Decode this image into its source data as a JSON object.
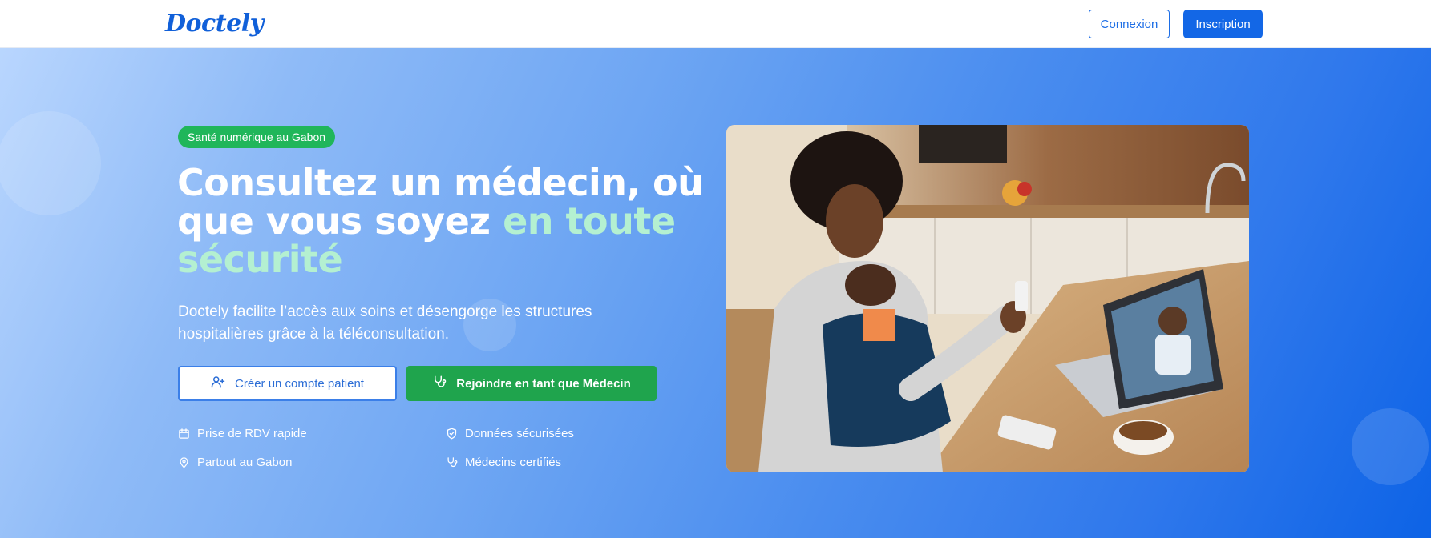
{
  "header": {
    "logo_text": "Doctely",
    "login_label": "Connexion",
    "signup_label": "Inscription"
  },
  "hero": {
    "badge": "Santé numérique au Gabon",
    "title_part1": "Consultez un médecin, où que vous soyez ",
    "title_highlight": "en toute sécurité",
    "description": "Doctely facilite l’accès aux soins et désengorge les structures hospitalières grâce à la téléconsultation.",
    "cta_patient": "Créer un compte patient",
    "cta_doctor": "Rejoindre en tant que Médecin",
    "features": [
      {
        "label": "Prise de RDV rapide",
        "icon": "calendar-icon"
      },
      {
        "label": "Données sécurisées",
        "icon": "shield-check-icon"
      },
      {
        "label": "Partout au Gabon",
        "icon": "map-pin-icon"
      },
      {
        "label": "Médecins certifiés",
        "icon": "stethoscope-icon"
      }
    ]
  },
  "colors": {
    "brand_blue": "#1367e6",
    "accent_green": "#1fa44d",
    "badge_green": "#20b65a",
    "highlight_mint": "#b4f0d1"
  }
}
